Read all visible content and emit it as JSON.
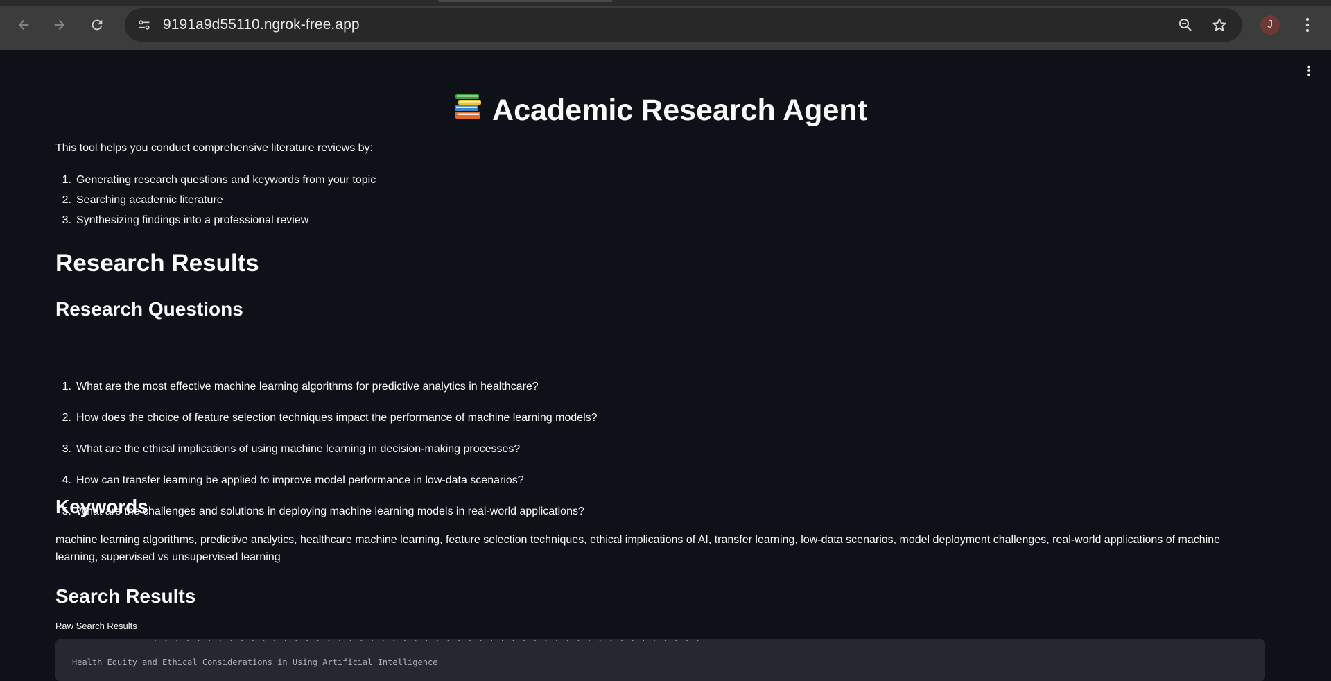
{
  "browser": {
    "url": "9191a9d55110.ngrok-free.app",
    "avatar_letter": "J",
    "icons": {
      "back": "arrow-left-icon",
      "forward": "arrow-right-icon",
      "reload": "reload-icon",
      "site_info": "tune-icon",
      "zoom": "zoom-out-icon",
      "bookmark": "star-icon",
      "menu": "more-vert-icon"
    }
  },
  "app": {
    "title": "Academic Research Agent",
    "title_icon": "books-icon",
    "intro": "This tool helps you conduct comprehensive literature reviews by:",
    "steps": [
      {
        "num": "1.",
        "text": "Generating research questions and keywords from your topic"
      },
      {
        "num": "2.",
        "text": "Searching academic literature"
      },
      {
        "num": "3.",
        "text": "Synthesizing findings into a professional review"
      }
    ],
    "results_heading": "Research Results",
    "questions_heading": "Research Questions",
    "questions": [
      {
        "num": "1.",
        "text": "What are the most effective machine learning algorithms for predictive analytics in healthcare?"
      },
      {
        "num": "2.",
        "text": "How does the choice of feature selection techniques impact the performance of machine learning models?"
      },
      {
        "num": "3.",
        "text": "What are the ethical implications of using machine learning in decision-making processes?"
      },
      {
        "num": "4.",
        "text": "How can transfer learning be applied to improve model performance in low-data scenarios?"
      },
      {
        "num": "5.",
        "text": "What are the challenges and solutions in deploying machine learning models in real-world applications?"
      }
    ],
    "keywords_heading": "Keywords",
    "keywords": "machine learning algorithms, predictive analytics, healthcare machine learning, feature selection techniques, ethical implications of AI, transfer learning, low-data scenarios, model deployment challenges, real-world applications of machine learning, supervised vs unsupervised learning",
    "search_heading": "Search Results",
    "raw_label": "Raw Search Results",
    "raw_partial_line": "Health Equity and Ethical Considerations in Using Artificial Intelligence"
  },
  "colors": {
    "background": "#0e1117",
    "text": "#fafafa",
    "code_bg": "#262730",
    "chrome_bg": "#3c3c3c",
    "omnibox_bg": "#282828",
    "avatar_bg": "#6b3a34"
  }
}
